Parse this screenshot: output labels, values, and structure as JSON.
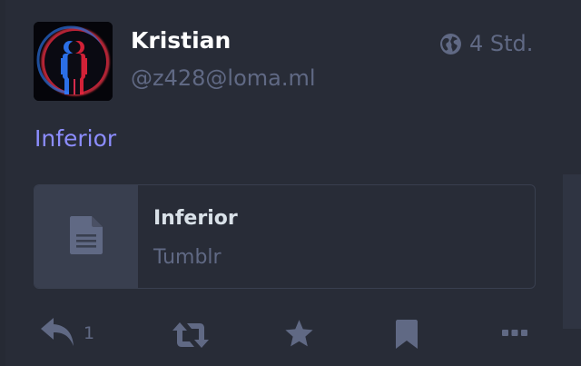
{
  "status": {
    "author": {
      "display_name": "Kristian",
      "handle": "@z428@loma.ml"
    },
    "visibility_icon": "globe-icon",
    "relative_time": "4 Std.",
    "content": "Inferior",
    "card": {
      "icon": "file-text-icon",
      "title": "Inferior",
      "provider": "Tumblr"
    },
    "actions": {
      "reply_icon": "reply-icon",
      "reply_count": "1",
      "boost_icon": "retweet-icon",
      "favourite_icon": "star-icon",
      "bookmark_icon": "bookmark-icon",
      "more_icon": "ellipsis-icon"
    }
  },
  "colors": {
    "background": "#282c37",
    "accent_link": "#8c8dff",
    "muted": "#606984",
    "card_border": "#393f4f"
  }
}
